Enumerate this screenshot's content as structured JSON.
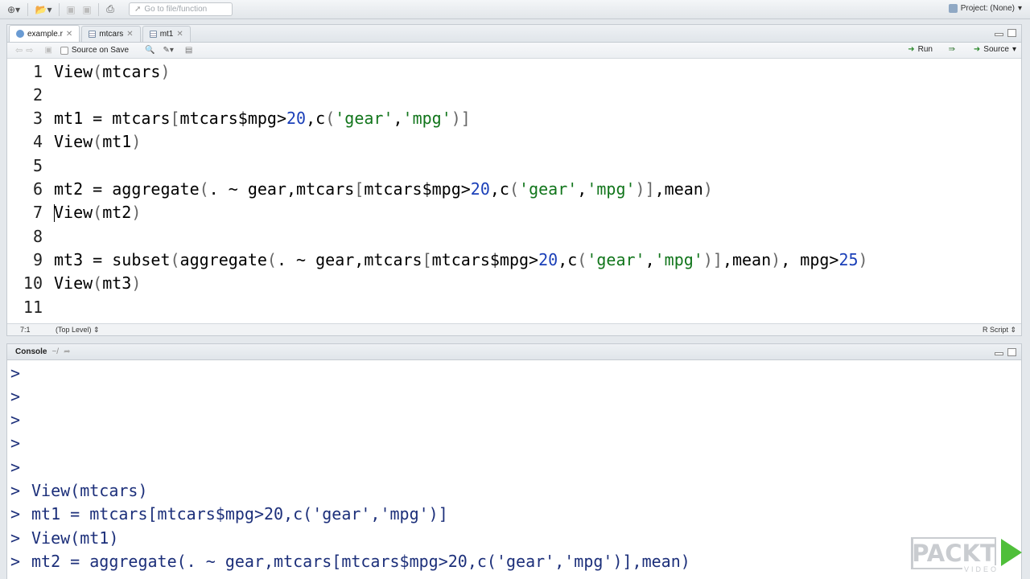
{
  "toolbar": {
    "goto_placeholder": "Go to file/function",
    "project_label": "Project: (None)"
  },
  "editor": {
    "tabs": [
      {
        "label": "example.r",
        "active": true
      },
      {
        "label": "mtcars",
        "active": false
      },
      {
        "label": "mt1",
        "active": false
      }
    ],
    "source_on_save": "Source on Save",
    "run_label": "Run",
    "source_label": "Source",
    "lines": [
      {
        "num": "1",
        "code": "View(mtcars)"
      },
      {
        "num": "2",
        "code": ""
      },
      {
        "num": "3",
        "code": "mt1 = mtcars[mtcars$mpg>20,c('gear','mpg')]"
      },
      {
        "num": "4",
        "code": "View(mt1)"
      },
      {
        "num": "5",
        "code": ""
      },
      {
        "num": "6",
        "code": "mt2 = aggregate(. ~ gear,mtcars[mtcars$mpg>20,c('gear','mpg')],mean)"
      },
      {
        "num": "7",
        "code": "View(mt2)"
      },
      {
        "num": "8",
        "code": ""
      },
      {
        "num": "9",
        "code": "mt3 = subset(aggregate(. ~ gear,mtcars[mtcars$mpg>20,c('gear','mpg')],mean), mpg>25)"
      },
      {
        "num": "10",
        "code": "View(mt3)"
      },
      {
        "num": "11",
        "code": ""
      }
    ],
    "status": {
      "position": "7:1",
      "scope": "(Top Level)",
      "file_type": "R Script"
    }
  },
  "console": {
    "title": "Console",
    "path": "~/",
    "lines": [
      {
        "prompt": ">",
        "cmd": ""
      },
      {
        "prompt": ">",
        "cmd": ""
      },
      {
        "prompt": ">",
        "cmd": ""
      },
      {
        "prompt": ">",
        "cmd": ""
      },
      {
        "prompt": ">",
        "cmd": ""
      },
      {
        "prompt": ">",
        "cmd": "View(mtcars)"
      },
      {
        "prompt": ">",
        "cmd": "mt1 = mtcars[mtcars$mpg>20,c('gear','mpg')]"
      },
      {
        "prompt": ">",
        "cmd": "View(mt1)"
      },
      {
        "prompt": ">",
        "cmd": "mt2 = aggregate(. ~ gear,mtcars[mtcars$mpg>20,c('gear','mpg')],mean)"
      }
    ]
  },
  "watermark": {
    "brand": "PACKT",
    "sub": "VIDEO"
  },
  "colors": {
    "string": "#11751b",
    "number": "#1a3fb8",
    "console_text": "#1c2f7a",
    "brand_green": "#4fbf3a"
  }
}
